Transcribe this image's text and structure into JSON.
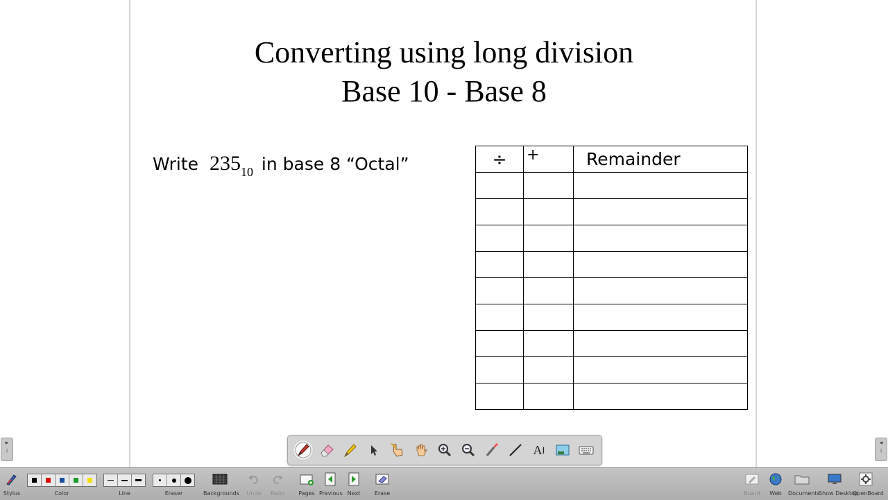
{
  "board": {
    "title_line1": "Converting using long division",
    "title_line2": "Base 10 - Base 8",
    "prompt": {
      "pre": "Write",
      "number": "235",
      "subscript": "10",
      "post": "in base 8 “Octal”"
    },
    "table": {
      "headers": [
        "÷",
        "+",
        "Remainder"
      ],
      "empty_rows": 9
    }
  },
  "tool_palette": [
    {
      "name": "pen-tool-icon",
      "active": true
    },
    {
      "name": "eraser-tool-icon"
    },
    {
      "name": "highlighter-tool-icon"
    },
    {
      "name": "select-arrow-icon"
    },
    {
      "name": "interact-hand-pointer-icon"
    },
    {
      "name": "pan-hand-icon"
    },
    {
      "name": "zoom-in-icon"
    },
    {
      "name": "zoom-out-icon"
    },
    {
      "name": "laser-pointer-icon"
    },
    {
      "name": "draw-line-icon"
    },
    {
      "name": "text-tool-icon",
      "glyph": "A"
    },
    {
      "name": "capture-tool-icon"
    },
    {
      "name": "virtual-keyboard-icon"
    }
  ],
  "bottom_toolbar": {
    "stylus_label": "Stylus",
    "color_label": "Color",
    "colors": [
      "#000000",
      "#e00000",
      "#1a4fa0",
      "#1a9a2a",
      "#f5e000"
    ],
    "line_label": "Line",
    "eraser_label": "Eraser",
    "backgrounds_label": "Backgrounds",
    "undo_label": "Undo",
    "redo_label": "Redo",
    "pages_label": "Pages",
    "previous_label": "Previous",
    "next_label": "Next",
    "erase_label": "Erase",
    "board_label": "Board",
    "web_label": "Web",
    "documents_label": "Documents",
    "show_desktop_label": "Show Desktop",
    "openboard_label": "OpenBoard"
  }
}
